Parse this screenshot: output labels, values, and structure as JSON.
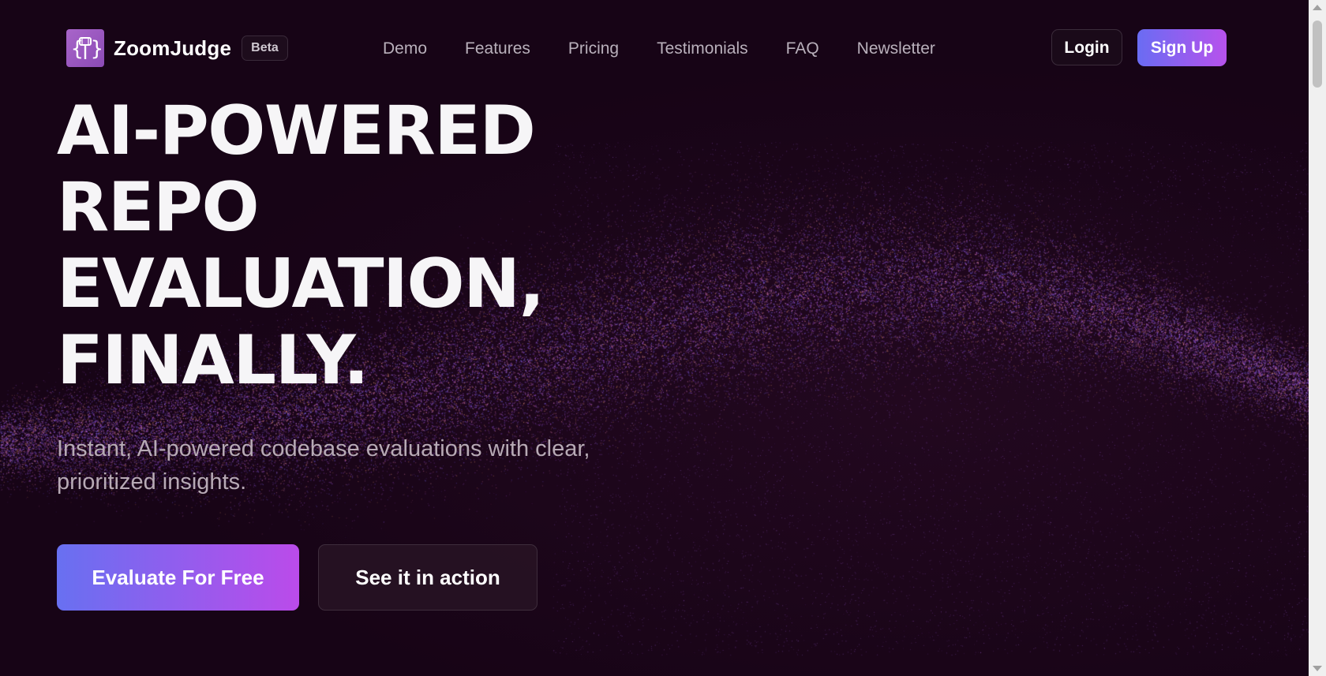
{
  "brand": {
    "name": "ZoomJudge",
    "badge": "Beta"
  },
  "nav": {
    "items": [
      "Demo",
      "Features",
      "Pricing",
      "Testimonials",
      "FAQ",
      "Newsletter"
    ]
  },
  "auth": {
    "login_label": "Login",
    "signup_label": "Sign Up"
  },
  "hero": {
    "title_lines": [
      "AI-POWERED",
      "REPO",
      "EVALUATION,",
      "FINALLY."
    ],
    "subtitle": "Instant, AI-powered codebase evaluations with clear, prioritized insights.",
    "primary_cta": "Evaluate For Free",
    "secondary_cta": "See it in action"
  },
  "colors": {
    "background": "#170416",
    "accent_start": "#6a6cf3",
    "accent_end": "#b752ec"
  }
}
